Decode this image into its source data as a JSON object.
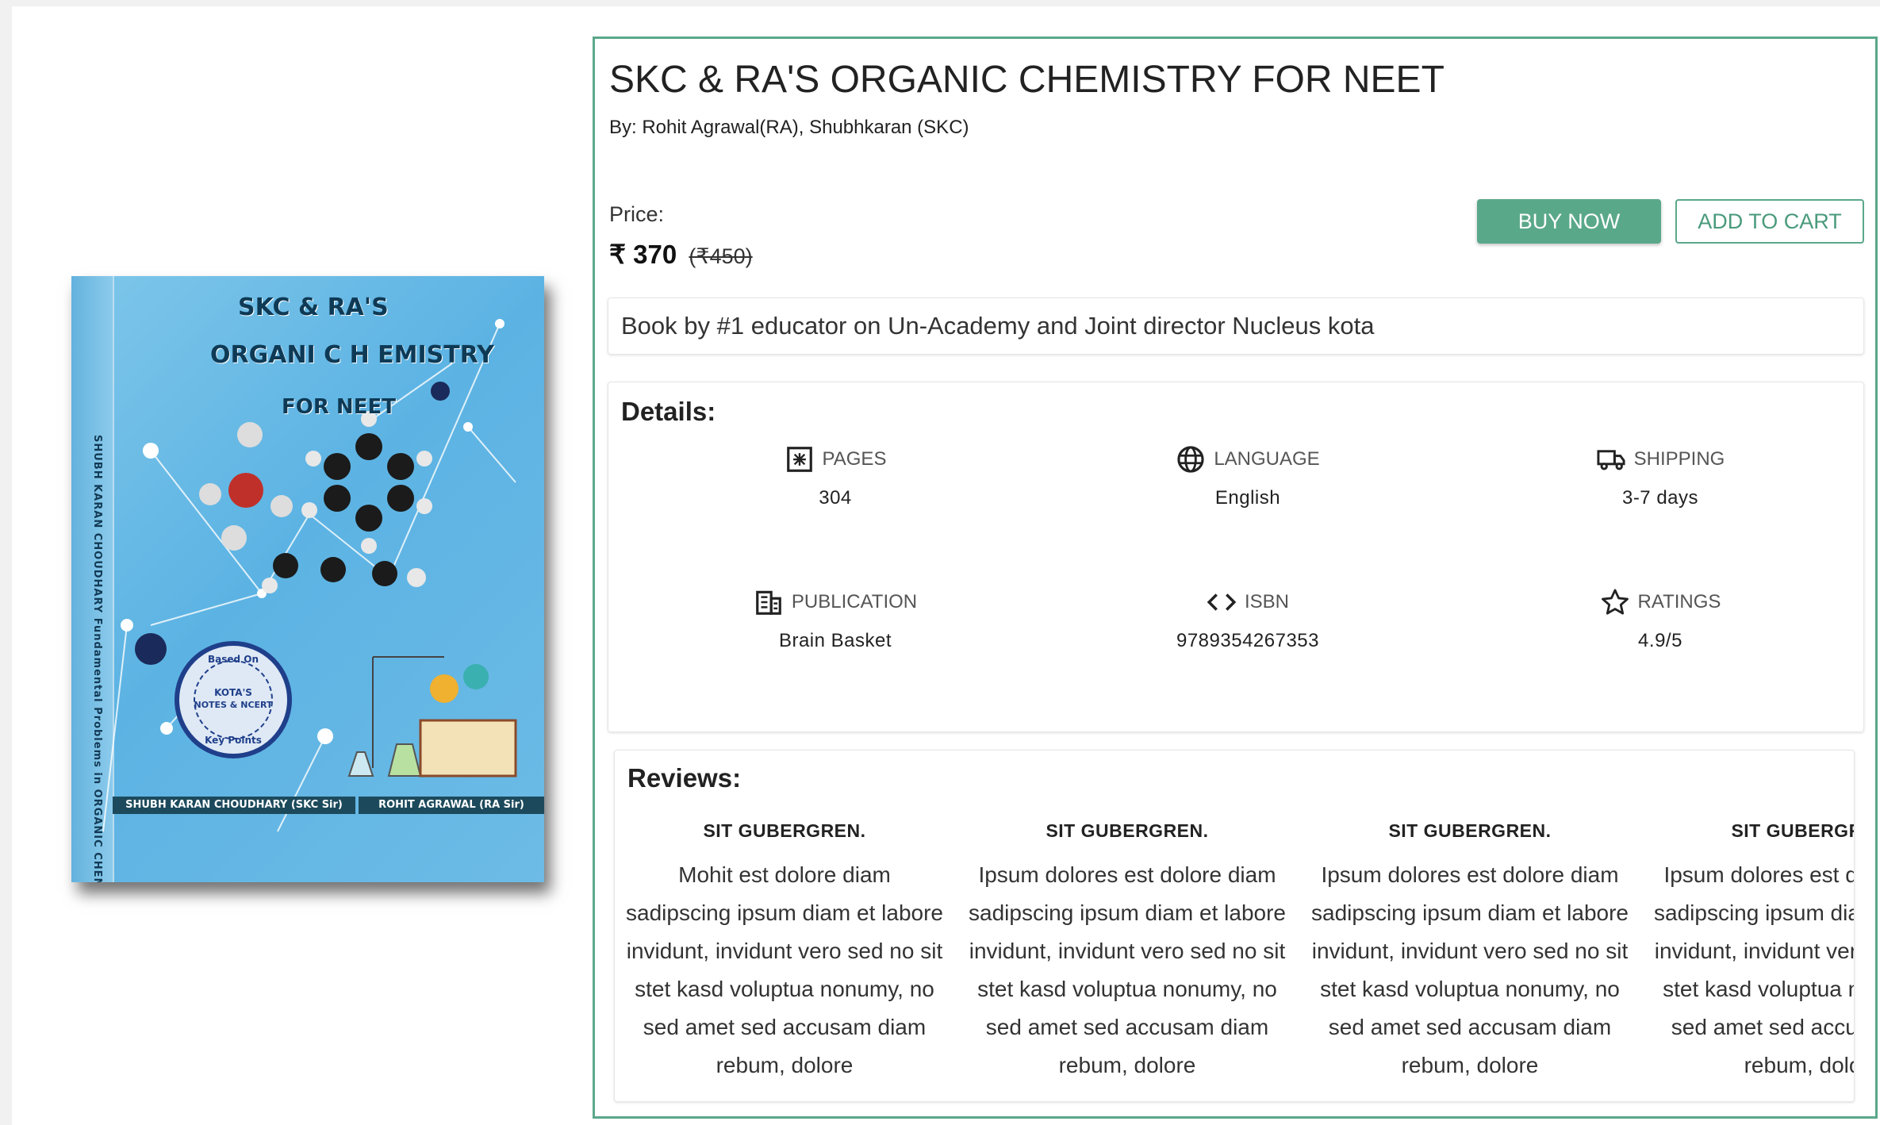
{
  "book": {
    "title": "SKC & RA'S ORGANIC CHEMISTRY FOR NEET",
    "authors": "By: Rohit Agrawal(RA), Shubhkaran (SKC)",
    "price_label": "Price:",
    "price": "₹ 370",
    "original_price": "(₹450)",
    "tagline": "Book by #1 educator on Un-Academy and Joint director Nucleus kota"
  },
  "cover": {
    "line1": "SKC & RA'S",
    "line2": "ORGANI C H EMISTRY",
    "line3": "FOR NEET",
    "spine": "SHUBH KARAN CHOUDHARY    Fundamental Problems in ORGANIC CHEMISTRY FOR NEET    ROHIT AGRAWAL",
    "seal_top": "Based On",
    "seal_mid1": "KOTA'S",
    "seal_mid2": "NOTES & NCERT",
    "seal_bottom": "Key Points",
    "author1": "SHUBH KARAN CHOUDHARY (SKC Sir)",
    "author2": "ROHIT AGRAWAL (RA Sir)"
  },
  "actions": {
    "buy_now": "BUY NOW",
    "add_to_cart": "ADD TO CART"
  },
  "details": {
    "title": "Details:",
    "items": [
      {
        "icon": "pages-icon",
        "label": "PAGES",
        "value": "304"
      },
      {
        "icon": "globe-icon",
        "label": "LANGUAGE",
        "value": "English"
      },
      {
        "icon": "truck-icon",
        "label": "SHIPPING",
        "value": "3-7 days"
      },
      {
        "icon": "building-icon",
        "label": "PUBLICATION",
        "value": "Brain Basket"
      },
      {
        "icon": "code-icon",
        "label": "ISBN",
        "value": "9789354267353"
      },
      {
        "icon": "star-icon",
        "label": "RATINGS",
        "value": "4.9/5"
      }
    ]
  },
  "reviews": {
    "title": "Reviews:",
    "items": [
      {
        "name": "SIT GUBERGREN.",
        "text": "Mohit est dolore diam sadipscing ipsum diam et labore invidunt, invidunt vero sed no sit stet kasd voluptua nonumy, no sed amet sed accusam diam rebum, dolore"
      },
      {
        "name": "SIT GUBERGREN.",
        "text": "Ipsum dolores est dolore diam sadipscing ipsum diam et labore invidunt, invidunt vero sed no sit stet kasd voluptua nonumy, no sed amet sed accusam diam rebum, dolore"
      },
      {
        "name": "SIT GUBERGREN.",
        "text": "Ipsum dolores est dolore diam sadipscing ipsum diam et labore invidunt, invidunt vero sed no sit stet kasd voluptua nonumy, no sed amet sed accusam diam rebum, dolore"
      },
      {
        "name": "SIT GUBERGREN.",
        "text": "Ipsum dolores est dolore diam sadipscing ipsum diam et labore invidunt, invidunt vero sed no sit stet kasd voluptua nonumy, no sed amet sed accusam diam rebum, dolore"
      }
    ]
  },
  "colors": {
    "accent": "#5aa88a",
    "cover_blue": "#6dbbe6",
    "cover_dark": "#1c4a5c"
  }
}
